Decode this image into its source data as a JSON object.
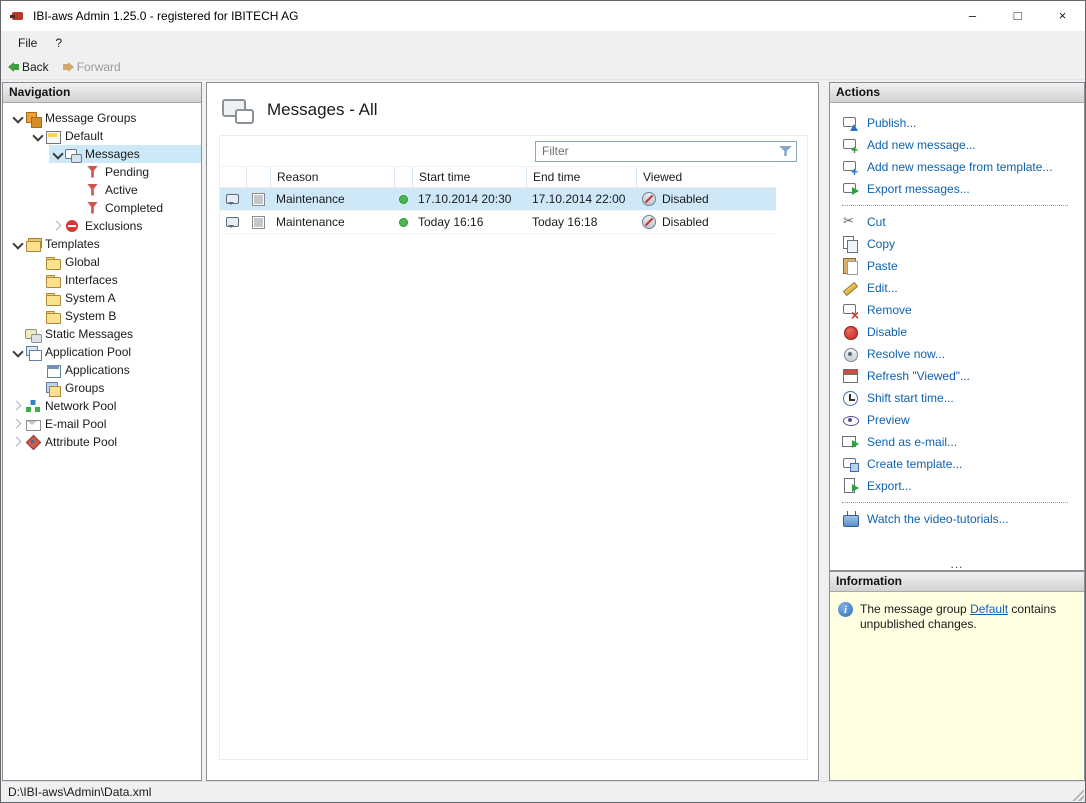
{
  "window": {
    "title": "IBI-aws Admin 1.25.0 - registered for IBITECH AG",
    "controls": {
      "minimize": "–",
      "maximize": "□",
      "close": "×"
    }
  },
  "colors": {
    "link": "#0f62b0",
    "tree_selection": "#cde8f6",
    "row_selection": "#cfe8f8",
    "info_background": "#ffffe1",
    "status_green": "#49b84f",
    "disabled_red": "#cc2d2d"
  },
  "menubar": {
    "items": [
      {
        "label": "File"
      },
      {
        "label": "?"
      }
    ]
  },
  "toolbar": {
    "back_label": "Back",
    "forward_label": "Forward"
  },
  "navigation": {
    "header": "Navigation",
    "items": [
      {
        "label": "Message Groups",
        "icon": "message-groups",
        "state": "expanded"
      },
      {
        "label": "Default",
        "icon": "message-group",
        "state": "expanded"
      },
      {
        "label": "Messages",
        "icon": "messages",
        "state": "expanded",
        "selected": true
      },
      {
        "label": "Pending",
        "icon": "filter"
      },
      {
        "label": "Active",
        "icon": "filter"
      },
      {
        "label": "Completed",
        "icon": "filter"
      },
      {
        "label": "Exclusions",
        "icon": "no-entry",
        "state": "collapsed"
      },
      {
        "label": "Templates",
        "icon": "folder-stack",
        "state": "expanded"
      },
      {
        "label": "Global",
        "icon": "folder"
      },
      {
        "label": "Interfaces",
        "icon": "folder"
      },
      {
        "label": "System A",
        "icon": "folder"
      },
      {
        "label": "System B",
        "icon": "folder"
      },
      {
        "label": "Static Messages",
        "icon": "static-messages"
      },
      {
        "label": "Application Pool",
        "icon": "application-pool",
        "state": "expanded"
      },
      {
        "label": "Applications",
        "icon": "application-window"
      },
      {
        "label": "Groups",
        "icon": "layered-groups"
      },
      {
        "label": "Network Pool",
        "icon": "network",
        "state": "collapsed"
      },
      {
        "label": "E-mail Pool",
        "icon": "envelope",
        "state": "collapsed"
      },
      {
        "label": "Attribute Pool",
        "icon": "attribute-tag",
        "state": "collapsed"
      }
    ]
  },
  "main": {
    "title": "Messages - All",
    "filter": {
      "placeholder": "Filter"
    },
    "table": {
      "columns": {
        "reason": "Reason",
        "start": "Start time",
        "end": "End time",
        "viewed": "Viewed"
      },
      "rows": [
        {
          "reason": "Maintenance",
          "status": "green",
          "start": "17.10.2014 20:30",
          "end": "17.10.2014 22:00",
          "viewed": "Disabled",
          "selected": true
        },
        {
          "reason": "Maintenance",
          "status": "green",
          "start": "Today 16:16",
          "end": "Today 16:18",
          "viewed": "Disabled",
          "selected": false
        }
      ]
    }
  },
  "actions": {
    "header": "Actions",
    "items": [
      {
        "label": "Publish...",
        "icon": "publish"
      },
      {
        "label": "Add new message...",
        "icon": "message-plus"
      },
      {
        "label": "Add new message from template...",
        "icon": "message-plus-template"
      },
      {
        "label": "Export messages...",
        "icon": "message-export"
      },
      {
        "label": "Cut",
        "icon": "scissors"
      },
      {
        "label": "Copy",
        "icon": "copy"
      },
      {
        "label": "Paste",
        "icon": "clipboard"
      },
      {
        "label": "Edit...",
        "icon": "pencil"
      },
      {
        "label": "Remove",
        "icon": "message-remove"
      },
      {
        "label": "Disable",
        "icon": "red-dot"
      },
      {
        "label": "Resolve now...",
        "icon": "resolve-circle"
      },
      {
        "label": "Refresh \"Viewed\"...",
        "icon": "refresh-grid"
      },
      {
        "label": "Shift start time...",
        "icon": "clock"
      },
      {
        "label": "Preview",
        "icon": "eye"
      },
      {
        "label": "Send as e-mail...",
        "icon": "envelope-send"
      },
      {
        "label": "Create template...",
        "icon": "message-template"
      },
      {
        "label": "Export...",
        "icon": "document-export"
      },
      {
        "label": "Watch the video-tutorials...",
        "icon": "tv"
      }
    ],
    "overflow": "..."
  },
  "information": {
    "header": "Information",
    "text_before": "The message group ",
    "link": "Default",
    "text_after": " contains unpublished changes."
  },
  "statusbar": {
    "path": "D:\\IBI-aws\\Admin\\Data.xml"
  }
}
